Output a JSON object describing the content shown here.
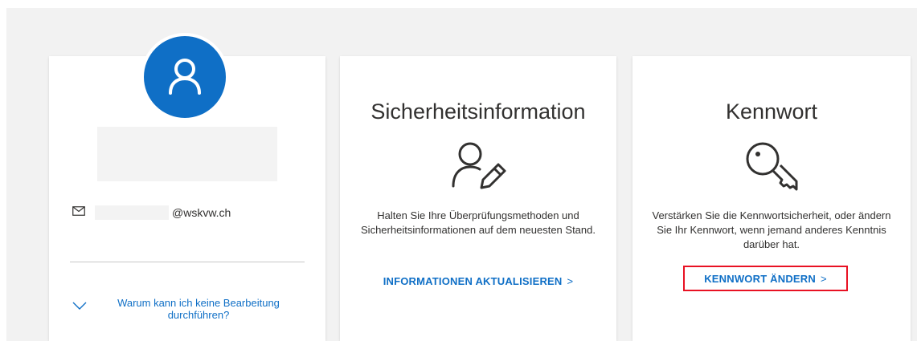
{
  "profile": {
    "email_domain": "@wskvw.ch",
    "why_link": "Warum kann ich keine Bearbeitung durchführen?",
    "avatar_icon": "person-icon",
    "mail_icon": "mail-icon"
  },
  "security": {
    "title": "Sicherheitsinformation",
    "description": "Halten Sie Ihre Überprüfungsmethoden und Sicherheitsinformationen auf dem neuesten Stand.",
    "link": "INFORMATIONEN AKTUALISIEREN",
    "arrow": ">",
    "icon": "person-edit-icon"
  },
  "password": {
    "title": "Kennwort",
    "description": "Verstärken Sie die Kennwortsicherheit, oder ändern Sie Ihr Kennwort, wenn jemand anderes Kenntnis darüber hat.",
    "link": "KENNWORT ÄNDERN",
    "arrow": ">",
    "icon": "key-icon"
  },
  "colors": {
    "accent": "#0f6fc6",
    "highlight": "#e81123",
    "background": "#f2f2f2"
  }
}
